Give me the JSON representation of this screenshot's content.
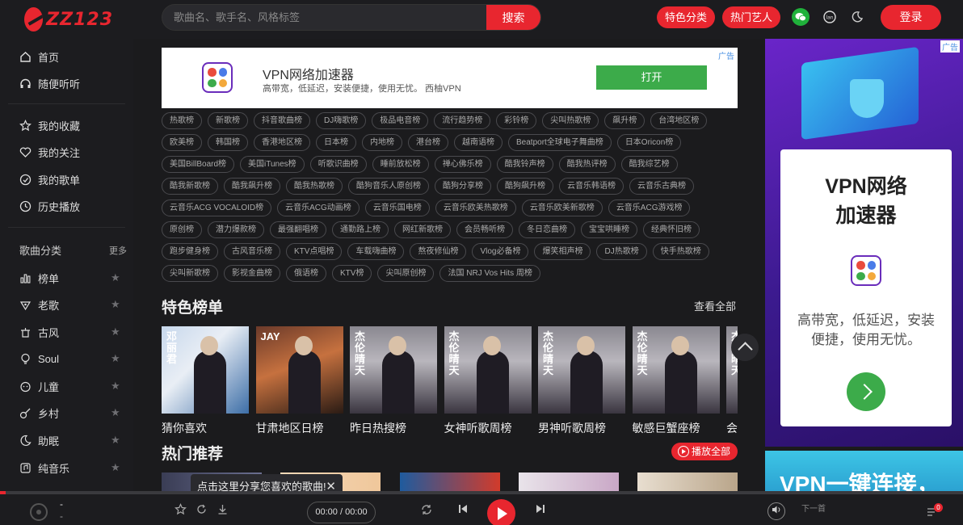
{
  "brand": {
    "logo_text": "ZZ123"
  },
  "search": {
    "placeholder": "歌曲名、歌手名、风格标签",
    "button": "搜索"
  },
  "header": {
    "feature_category": "特色分类",
    "hot_artists": "热门艺人",
    "login": "登录"
  },
  "sidebar": {
    "primary": [
      {
        "label": "首页",
        "icon": "home-icon"
      },
      {
        "label": "随便听听",
        "icon": "headphones-icon"
      }
    ],
    "personal": [
      {
        "label": "我的收藏",
        "icon": "star-outline-icon"
      },
      {
        "label": "我的关注",
        "icon": "heart-icon"
      },
      {
        "label": "我的歌单",
        "icon": "playlist-icon"
      },
      {
        "label": "历史播放",
        "icon": "history-icon"
      }
    ],
    "category_title": "歌曲分类",
    "more": "更多",
    "categories": [
      {
        "label": "榜单",
        "icon": "bars-icon"
      },
      {
        "label": "老歌",
        "icon": "vinyl-icon"
      },
      {
        "label": "古风",
        "icon": "lantern-icon"
      },
      {
        "label": "Soul",
        "icon": "bulb-icon"
      },
      {
        "label": "儿童",
        "icon": "child-icon"
      },
      {
        "label": "乡村",
        "icon": "guitar-icon"
      },
      {
        "label": "助眠",
        "icon": "moon-icon"
      },
      {
        "label": "纯音乐",
        "icon": "music-note-icon"
      }
    ]
  },
  "ad_top": {
    "tag": "广告",
    "title": "VPN网络加速器",
    "subtitle": "高带宽，低延迟，安装便捷，使用无忧。 西柚VPN",
    "button": "打开"
  },
  "tags": [
    [
      "热歌榜",
      "新歌榜",
      "抖音歌曲榜",
      "DJ嗨歌榜",
      "极品电音榜",
      "流行趋势榜",
      "彩铃榜",
      "尖叫热歌榜",
      "飙升榜",
      "台湾地区榜"
    ],
    [
      "欧美榜",
      "韩国榜",
      "香港地区榜",
      "日本榜",
      "内地榜",
      "港台榜",
      "越南语榜",
      "Beatport全球电子舞曲榜",
      "日本Oricon榜"
    ],
    [
      "美国BillBoard榜",
      "美国iTunes榜",
      "听歌识曲榜",
      "睡前放松榜",
      "禅心佛乐榜",
      "酷我铃声榜",
      "酷我热评榜",
      "酷我综艺榜"
    ],
    [
      "酷我新歌榜",
      "酷我飙升榜",
      "酷我热歌榜",
      "酷狗音乐人原创榜",
      "酷狗分享榜",
      "酷狗飙升榜",
      "云音乐韩语榜",
      "云音乐古典榜"
    ],
    [
      "云音乐ACG VOCALOID榜",
      "云音乐ACG动画榜",
      "云音乐国电榜",
      "云音乐欧美热歌榜",
      "云音乐欧美新歌榜",
      "云音乐ACG游戏榜"
    ],
    [
      "原创榜",
      "潜力爆款榜",
      "最强翻唱榜",
      "通勤路上榜",
      "网红新歌榜",
      "会员畅听榜",
      "冬日恋曲榜",
      "宝宝哄睡榜",
      "经典怀旧榜"
    ],
    [
      "跑步健身榜",
      "古风音乐榜",
      "KTV点唱榜",
      "车载嗨曲榜",
      "熬夜修仙榜",
      "Vlog必备榜",
      "爆笑相声榜",
      "DJ热歌榜",
      "快手热歌榜"
    ],
    [
      "尖叫新歌榜",
      "影视金曲榜",
      "俄语榜",
      "KTV榜",
      "尖叫原创榜",
      "法国 NRJ Vos Hits 周榜"
    ]
  ],
  "featured": {
    "title": "特色榜单",
    "see_all": "查看全部",
    "cards": [
      {
        "label": "猜你喜欢",
        "cover_text": "邓丽君"
      },
      {
        "label": "甘肃地区日榜",
        "cover_text": "JAY"
      },
      {
        "label": "昨日热搜榜",
        "cover_text": "杰伦晴天"
      },
      {
        "label": "女神听歌周榜",
        "cover_text": "杰伦晴天"
      },
      {
        "label": "男神听歌周榜",
        "cover_text": "杰伦晴天"
      },
      {
        "label": "敏感巨蟹座榜",
        "cover_text": "杰伦晴天"
      },
      {
        "label": "会员",
        "cover_text": "杰伦晴天"
      }
    ]
  },
  "hot": {
    "title": "热门推荐",
    "play_all": "播放全部"
  },
  "ad_right": {
    "tag": "广告",
    "title_line1": "VPN网络",
    "title_line2": "加速器",
    "subtitle": "高带宽，低延迟，安装便捷，使用无忧。",
    "banner_text": "VPN一键连接，"
  },
  "toast": {
    "text": "点击这里分享您喜欢的歌曲!"
  },
  "player": {
    "title": "-",
    "artist": "-",
    "time": "00:00 / 00:00",
    "next_label": "下一首",
    "queue_count": "0",
    "progress": 0.006
  },
  "colors": {
    "accent": "#e8262f",
    "background": "#1b1b1d",
    "ad_green": "#3cab4a"
  }
}
